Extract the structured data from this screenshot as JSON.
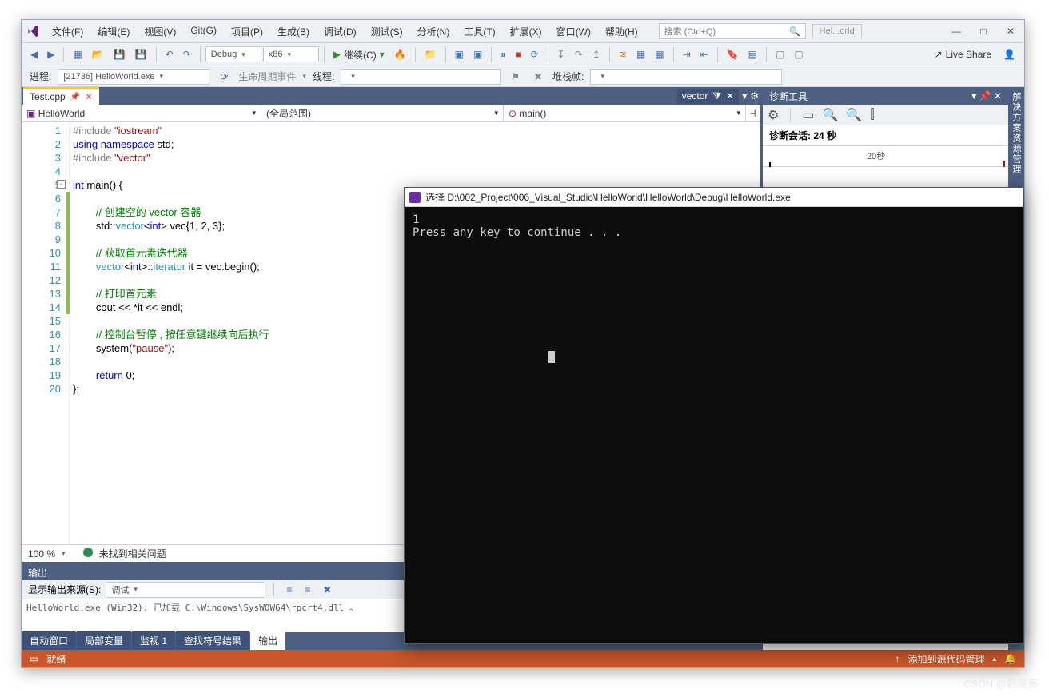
{
  "menu": [
    "文件(F)",
    "编辑(E)",
    "视图(V)",
    "Git(G)",
    "项目(P)",
    "生成(B)",
    "调试(D)",
    "测试(S)",
    "分析(N)",
    "工具(T)",
    "扩展(X)",
    "窗口(W)",
    "帮助(H)"
  ],
  "title": {
    "search_placeholder": "搜索 (Ctrl+Q)",
    "project_short": "Hel...orld",
    "minimize": "—",
    "maximize": "□",
    "close": "✕"
  },
  "toolbar": {
    "config": "Debug",
    "platform": "x86",
    "continue": "继续(C)",
    "live_share": "Live Share"
  },
  "toolbar2": {
    "process_label": "进程:",
    "process_value": "[21736] HelloWorld.exe",
    "lifecycle": "生命周期事件",
    "thread_label": "线程:",
    "stack_label": "堆栈帧:"
  },
  "doc_tab": {
    "name": "Test.cpp"
  },
  "nav": {
    "right_pill": "vector",
    "scope_left": "HelloWorld",
    "scope_mid": "(全局范围)",
    "scope_right": "main()"
  },
  "code": {
    "lines": [
      {
        "n": 1,
        "seg": [
          {
            "c": "pre",
            "t": "#include "
          },
          {
            "c": "str",
            "t": "\"iostream\""
          }
        ]
      },
      {
        "n": 2,
        "seg": [
          {
            "c": "kw",
            "t": "using "
          },
          {
            "c": "kw",
            "t": "namespace"
          },
          {
            "c": "",
            "t": " std;"
          }
        ]
      },
      {
        "n": 3,
        "seg": [
          {
            "c": "pre",
            "t": "#include "
          },
          {
            "c": "str",
            "t": "\"vector\""
          }
        ]
      },
      {
        "n": 4,
        "seg": []
      },
      {
        "n": 5,
        "fold": true,
        "seg": [
          {
            "c": "kw",
            "t": "int"
          },
          {
            "c": "",
            "t": " main() {"
          }
        ]
      },
      {
        "n": 6,
        "bar": true,
        "seg": []
      },
      {
        "n": 7,
        "bar": true,
        "indent": 2,
        "seg": [
          {
            "c": "cmt",
            "t": "// 创建空的 vector 容器"
          }
        ]
      },
      {
        "n": 8,
        "bar": true,
        "indent": 2,
        "seg": [
          {
            "c": "",
            "t": "std::"
          },
          {
            "c": "typ",
            "t": "vector"
          },
          {
            "c": "",
            "t": "<"
          },
          {
            "c": "kw",
            "t": "int"
          },
          {
            "c": "",
            "t": "> vec{1, 2, 3};"
          }
        ]
      },
      {
        "n": 9,
        "bar": true,
        "seg": []
      },
      {
        "n": 10,
        "bar": true,
        "indent": 2,
        "seg": [
          {
            "c": "cmt",
            "t": "// 获取首元素迭代器"
          }
        ]
      },
      {
        "n": 11,
        "bar": true,
        "indent": 2,
        "seg": [
          {
            "c": "typ",
            "t": "vector"
          },
          {
            "c": "",
            "t": "<"
          },
          {
            "c": "kw",
            "t": "int"
          },
          {
            "c": "",
            "t": ">::"
          },
          {
            "c": "typ",
            "t": "iterator"
          },
          {
            "c": "",
            "t": " it = vec.begin();"
          }
        ]
      },
      {
        "n": 12,
        "bar": true,
        "seg": []
      },
      {
        "n": 13,
        "bar": true,
        "indent": 2,
        "seg": [
          {
            "c": "cmt",
            "t": "// 打印首元素"
          }
        ]
      },
      {
        "n": 14,
        "bar": true,
        "indent": 2,
        "seg": [
          {
            "c": "",
            "t": "cout << *it << endl;"
          }
        ]
      },
      {
        "n": 15,
        "seg": []
      },
      {
        "n": 16,
        "indent": 2,
        "seg": [
          {
            "c": "cmt",
            "t": "// 控制台暂停 , 按任意键继续向后执行"
          }
        ]
      },
      {
        "n": 17,
        "indent": 2,
        "seg": [
          {
            "c": "",
            "t": "system("
          },
          {
            "c": "str",
            "t": "\"pause\""
          },
          {
            "c": "",
            "t": ");"
          }
        ]
      },
      {
        "n": 18,
        "seg": []
      },
      {
        "n": 19,
        "indent": 2,
        "seg": [
          {
            "c": "kw",
            "t": "return"
          },
          {
            "c": "",
            "t": " 0;"
          }
        ]
      },
      {
        "n": 20,
        "seg": [
          {
            "c": "",
            "t": "};"
          }
        ]
      }
    ]
  },
  "error_strip": {
    "zoom": "100 %",
    "msg": "未找到相关问题"
  },
  "output": {
    "title": "输出",
    "src_label": "显示输出来源(S):",
    "src_value": "调试",
    "body": "HelloWorld.exe  (Win32):  已加载  C:\\Windows\\SysWOW64\\rpcrt4.dll  。",
    "tabs": [
      "自动窗口",
      "局部变量",
      "监视 1",
      "查找符号结果",
      "输出"
    ],
    "active_tab": 4
  },
  "diag": {
    "title": "诊断工具",
    "session": "诊断会话: 24 秒",
    "tick": "20秒"
  },
  "side_strip": "解决方案资源管理",
  "status": {
    "ready": "就绪",
    "scm": "添加到源代码管理"
  },
  "console": {
    "title": "选择 D:\\002_Project\\006_Visual_Studio\\HelloWorld\\HelloWorld\\Debug\\HelloWorld.exe",
    "lines": [
      "1",
      "Press any key to continue . . ."
    ]
  },
  "watermark": "CSDN @韩曙亮"
}
